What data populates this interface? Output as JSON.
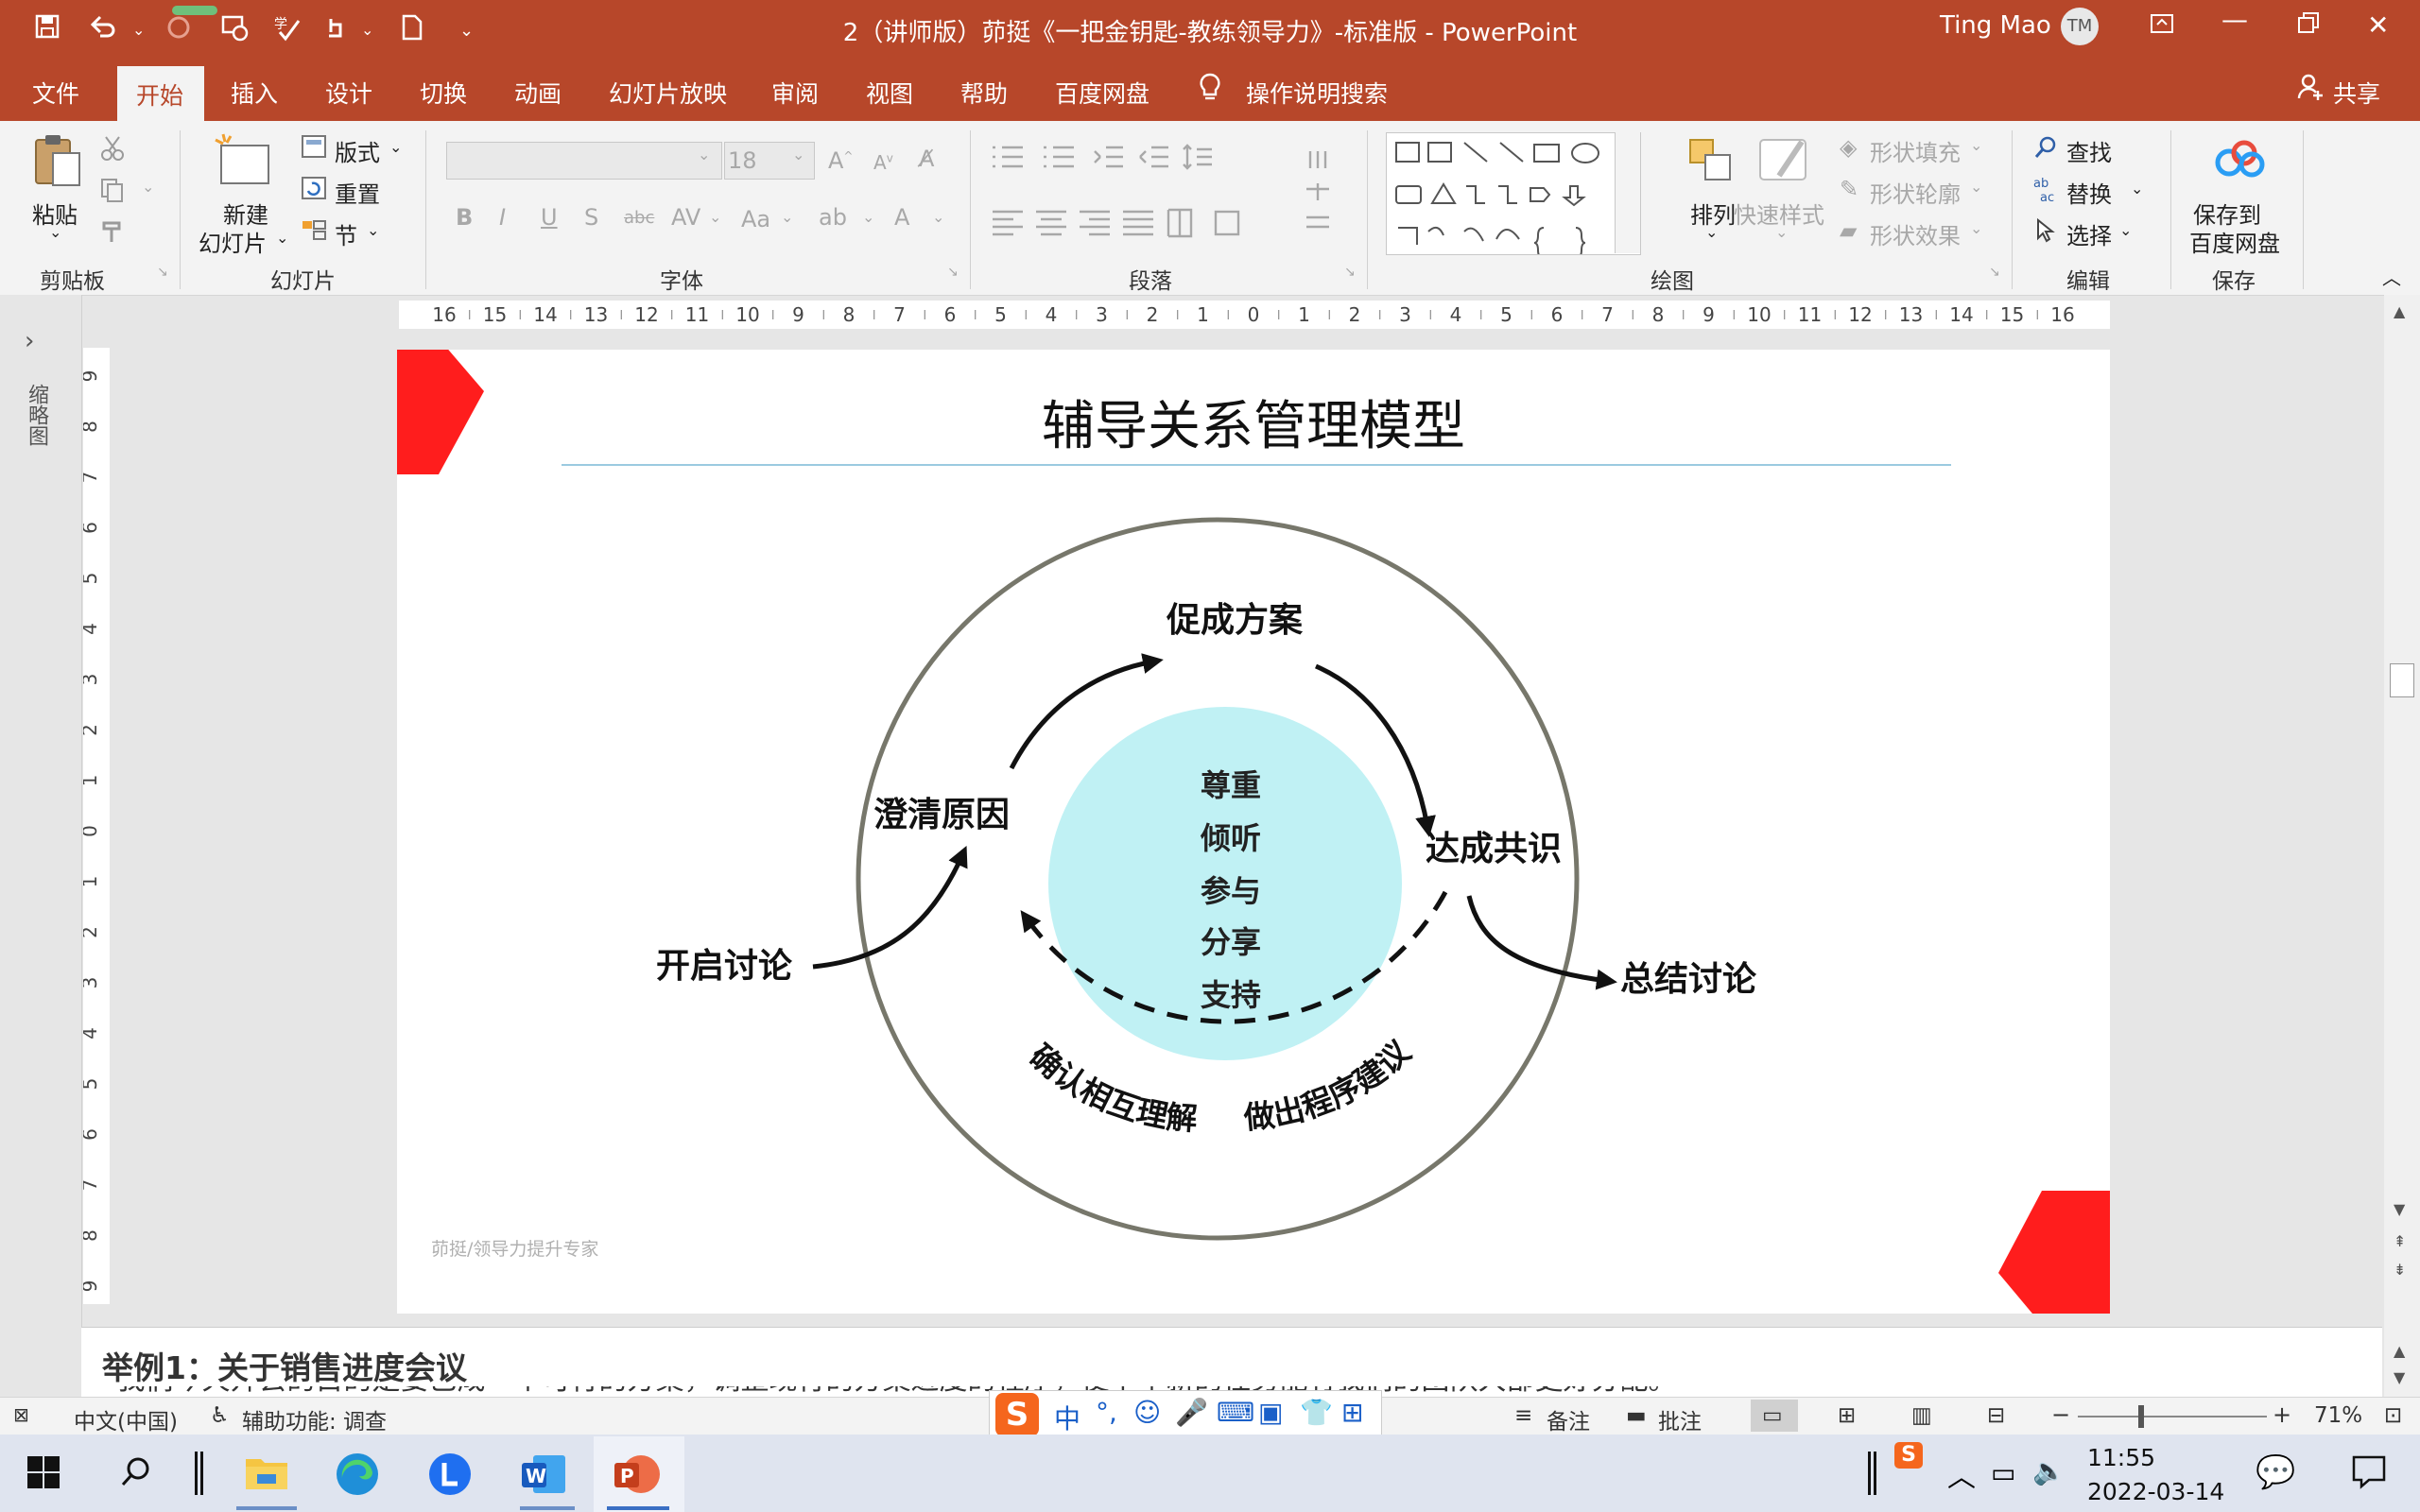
{
  "window": {
    "title": "2（讲师版）茆挺《一把金钥匙-教练领导力》-标准版  -  PowerPoint",
    "user": "Ting Mao",
    "avatar_initials": "TM"
  },
  "tabs": [
    "文件",
    "开始",
    "插入",
    "设计",
    "切换",
    "动画",
    "幻灯片放映",
    "审阅",
    "视图",
    "帮助",
    "百度网盘"
  ],
  "tell_me": "操作说明搜索",
  "share": "共享",
  "ribbon": {
    "clipboard": {
      "paste": "粘贴",
      "label": "剪贴板"
    },
    "slides": {
      "new_line1": "新建",
      "new_line2": "幻灯片",
      "layout": "版式",
      "reset": "重置",
      "section": "节",
      "label": "幻灯片"
    },
    "font": {
      "size": "18",
      "label": "字体"
    },
    "paragraph": {
      "label": "段落"
    },
    "drawing": {
      "arrange": "排列",
      "quick_styles": "快速样式",
      "fill": "形状填充",
      "outline": "形状轮廓",
      "effects": "形状效果",
      "label": "绘图"
    },
    "editing": {
      "find": "查找",
      "replace": "替换",
      "select": "选择",
      "label": "编辑"
    },
    "save": {
      "line1": "保存到",
      "line2": "百度网盘",
      "label": "保存"
    }
  },
  "thumbnail_pane_label": "缩略图",
  "ruler_h": [
    "16",
    "15",
    "14",
    "13",
    "12",
    "11",
    "10",
    "9",
    "8",
    "7",
    "6",
    "5",
    "4",
    "3",
    "2",
    "1",
    "0",
    "1",
    "2",
    "3",
    "4",
    "5",
    "6",
    "7",
    "8",
    "9",
    "10",
    "11",
    "12",
    "13",
    "14",
    "15",
    "16"
  ],
  "ruler_v": [
    "9",
    "8",
    "7",
    "6",
    "5",
    "4",
    "3",
    "2",
    "1",
    "0",
    "1",
    "2",
    "3",
    "4",
    "5",
    "6",
    "7",
    "8",
    "9"
  ],
  "slide": {
    "title": "辅导关系管理模型",
    "center_items": [
      "尊重",
      "倾听",
      "参与",
      "分享",
      "支持"
    ],
    "steps": {
      "open": "开启讨论",
      "clarify": "澄清原因",
      "promote": "促成方案",
      "agree": "达成共识",
      "summary": "总结讨论",
      "confirm": "确认相互理解",
      "procedure": "做出程序建议"
    },
    "footer": "茆挺/领导力提升专家",
    "colors": {
      "accent_red": "#ff1d1d",
      "inner_circle": "#c0f1f4",
      "outer_ring": "#77776b",
      "title_rule": "#7ab8d6"
    }
  },
  "notes": {
    "heading": "举例1：关于销售进度会议",
    "line2": "“我们今天开会的目的是要已成一个可行的方案，调整现行的方案进度的程序，使下个新的任务能有我们的团队大部更好分配。”"
  },
  "status": {
    "language": "中文(中国)",
    "accessibility": "辅助功能: 调查",
    "notes_btn": "备注",
    "comments_btn": "批注",
    "zoom": "71%"
  },
  "ime": {
    "lang": "中",
    "punct": "°,"
  },
  "taskbar": {
    "time": "11:55",
    "date": "2022-03-14"
  }
}
